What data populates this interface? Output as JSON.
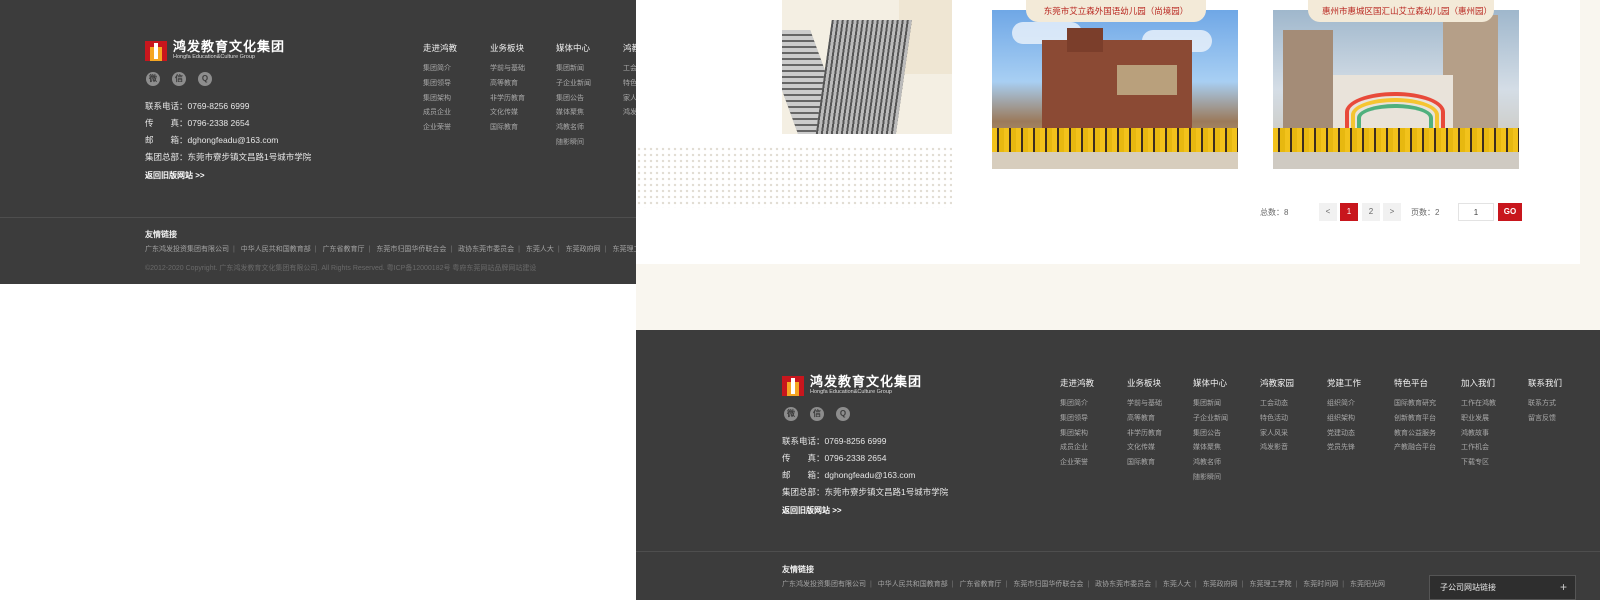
{
  "footer": {
    "logo": {
      "cn": "鸿发教育文化集团",
      "en": "Hongfa Education&Culture Group"
    },
    "social": [
      {
        "name": "weibo-icon",
        "glyph": "微"
      },
      {
        "name": "wechat-icon",
        "glyph": "信"
      },
      {
        "name": "qq-icon",
        "glyph": "Q"
      }
    ],
    "contact": {
      "phone_label": "联系电话：",
      "phone": "0769-8256 6999",
      "fax_label": "传　　真：",
      "fax": "0796-2338 2654",
      "email_label": "邮　　箱：",
      "email": "dghongfeadu@163.com",
      "hq_label": "集团总部：",
      "hq": "东莞市寮步镇文昌路1号城市学院"
    },
    "old_site": "返回旧版网站 >>",
    "nav": [
      {
        "title": "走进鸿教",
        "items": [
          "集团简介",
          "集团领导",
          "集团架构",
          "成员企业",
          "企业荣誉"
        ]
      },
      {
        "title": "业务板块",
        "items": [
          "学前与基础",
          "高等教育",
          "非学历教育",
          "文化传媒",
          "国际教育"
        ]
      },
      {
        "title": "媒体中心",
        "items": [
          "集团新闻",
          "子企业新闻",
          "集团公告",
          "媒体聚焦",
          "鸿教名师",
          "随影瞬间"
        ]
      },
      {
        "title": "鸿教家园",
        "items": [
          "工会动态",
          "特色活动",
          "家人风采",
          "鸿发影音"
        ]
      },
      {
        "title": "党建工作",
        "items": [
          "组织简介",
          "组织架构",
          "党建动态",
          "党员先锋"
        ]
      },
      {
        "title": "特色平台",
        "items": [
          "国际教育研究",
          "创新教育平台",
          "教育公益服务",
          "产教融合平台"
        ]
      },
      {
        "title": "加入我们",
        "items": [
          "工作在鸿教",
          "职业发展",
          "鸿教故事",
          "工作机会",
          "下载专区"
        ]
      },
      {
        "title": "联系我们",
        "items": [
          "联系方式",
          "留言反馈"
        ]
      }
    ],
    "friend_title": "友情链接",
    "friend_links": [
      "广东鸿发投资集团有限公司",
      "中华人民共和国教育部",
      "广东省教育厅",
      "东莞市归国华侨联合会",
      "政协东莞市委员会",
      "东莞人大",
      "东莞政府网",
      "东莞理工学院",
      "东莞时间网",
      "东莞阳光网"
    ],
    "copyright": "©2012-2020 Copyright. 广东鸿发教育文化集团有限公司. All Rights Reserved. 粤ICP备12000182号  粤府东莞网站品牌网站建设"
  },
  "schools": [
    {
      "caption": "东莞市艾立森外国语幼儿园（尚境园）"
    },
    {
      "caption": "惠州市惠城区国汇山艾立森幼儿园（惠州园）"
    }
  ],
  "pagination": {
    "total_label": "总数：",
    "total": "8",
    "prev": "<",
    "pages": [
      "1",
      "2"
    ],
    "current": "1",
    "next": ">",
    "page_count_label": "页数：",
    "page_count": "2",
    "input_value": "1",
    "go": "GO"
  },
  "subsite": {
    "label": "子公司网站链接",
    "plus": "+"
  },
  "colors": {
    "footer_bg": "#3c3c3c",
    "accent_red": "#c8161d",
    "cream": "#f9f6ef"
  }
}
